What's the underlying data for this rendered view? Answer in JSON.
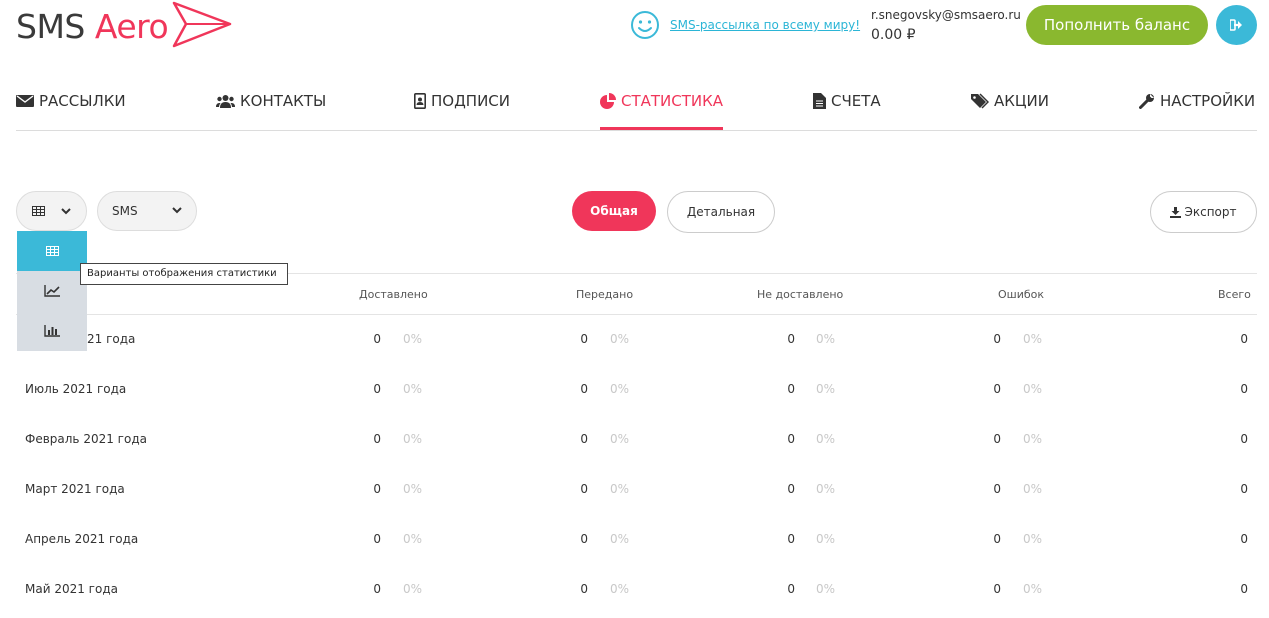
{
  "header": {
    "logo_sms": "SMS",
    "logo_aero": "Aero",
    "promo_link": "SMS-рассылка по всему миру!",
    "email": "r.snegovsky@smsaero.ru",
    "balance": "0.00 ₽",
    "topup_label": "Пополнить баланс"
  },
  "nav": {
    "items": [
      {
        "label": "РАССЫЛКИ",
        "icon": "envelope-icon"
      },
      {
        "label": "КОНТАКТЫ",
        "icon": "users-icon"
      },
      {
        "label": "ПОДПИСИ",
        "icon": "id-badge-icon"
      },
      {
        "label": "СТАТИСТИКА",
        "icon": "pie-chart-icon",
        "active": true
      },
      {
        "label": "СЧЕТА",
        "icon": "file-icon"
      },
      {
        "label": "АКЦИИ",
        "icon": "tags-icon"
      },
      {
        "label": "НАСТРОЙКИ",
        "icon": "wrench-icon"
      }
    ]
  },
  "toolbar": {
    "type_value": "SMS",
    "general_label": "Общая",
    "detailed_label": "Детальная",
    "export_label": "Экспорт",
    "tooltip": "Варианты отображения статистики"
  },
  "table": {
    "headers": [
      "Доставлено",
      "Передано",
      "Не доставлено",
      "Ошибок",
      "Всего"
    ],
    "rows": [
      {
        "label": "21 года",
        "delivered": "0",
        "delivered_pct": "0%",
        "sent": "0",
        "sent_pct": "0%",
        "not_delivered": "0",
        "not_delivered_pct": "0%",
        "errors": "0",
        "errors_pct": "0%",
        "total": "0"
      },
      {
        "label": "Июль 2021 года",
        "delivered": "0",
        "delivered_pct": "0%",
        "sent": "0",
        "sent_pct": "0%",
        "not_delivered": "0",
        "not_delivered_pct": "0%",
        "errors": "0",
        "errors_pct": "0%",
        "total": "0"
      },
      {
        "label": "Февраль 2021 года",
        "delivered": "0",
        "delivered_pct": "0%",
        "sent": "0",
        "sent_pct": "0%",
        "not_delivered": "0",
        "not_delivered_pct": "0%",
        "errors": "0",
        "errors_pct": "0%",
        "total": "0"
      },
      {
        "label": "Март 2021 года",
        "delivered": "0",
        "delivered_pct": "0%",
        "sent": "0",
        "sent_pct": "0%",
        "not_delivered": "0",
        "not_delivered_pct": "0%",
        "errors": "0",
        "errors_pct": "0%",
        "total": "0"
      },
      {
        "label": "Апрель 2021 года",
        "delivered": "0",
        "delivered_pct": "0%",
        "sent": "0",
        "sent_pct": "0%",
        "not_delivered": "0",
        "not_delivered_pct": "0%",
        "errors": "0",
        "errors_pct": "0%",
        "total": "0"
      },
      {
        "label": "Май 2021 года",
        "delivered": "0",
        "delivered_pct": "0%",
        "sent": "0",
        "sent_pct": "0%",
        "not_delivered": "0",
        "not_delivered_pct": "0%",
        "errors": "0",
        "errors_pct": "0%",
        "total": "0"
      }
    ]
  },
  "colors": {
    "brand_red": "#f0365a",
    "accent_green": "#8ab82f",
    "accent_blue": "#3bb9d8"
  }
}
